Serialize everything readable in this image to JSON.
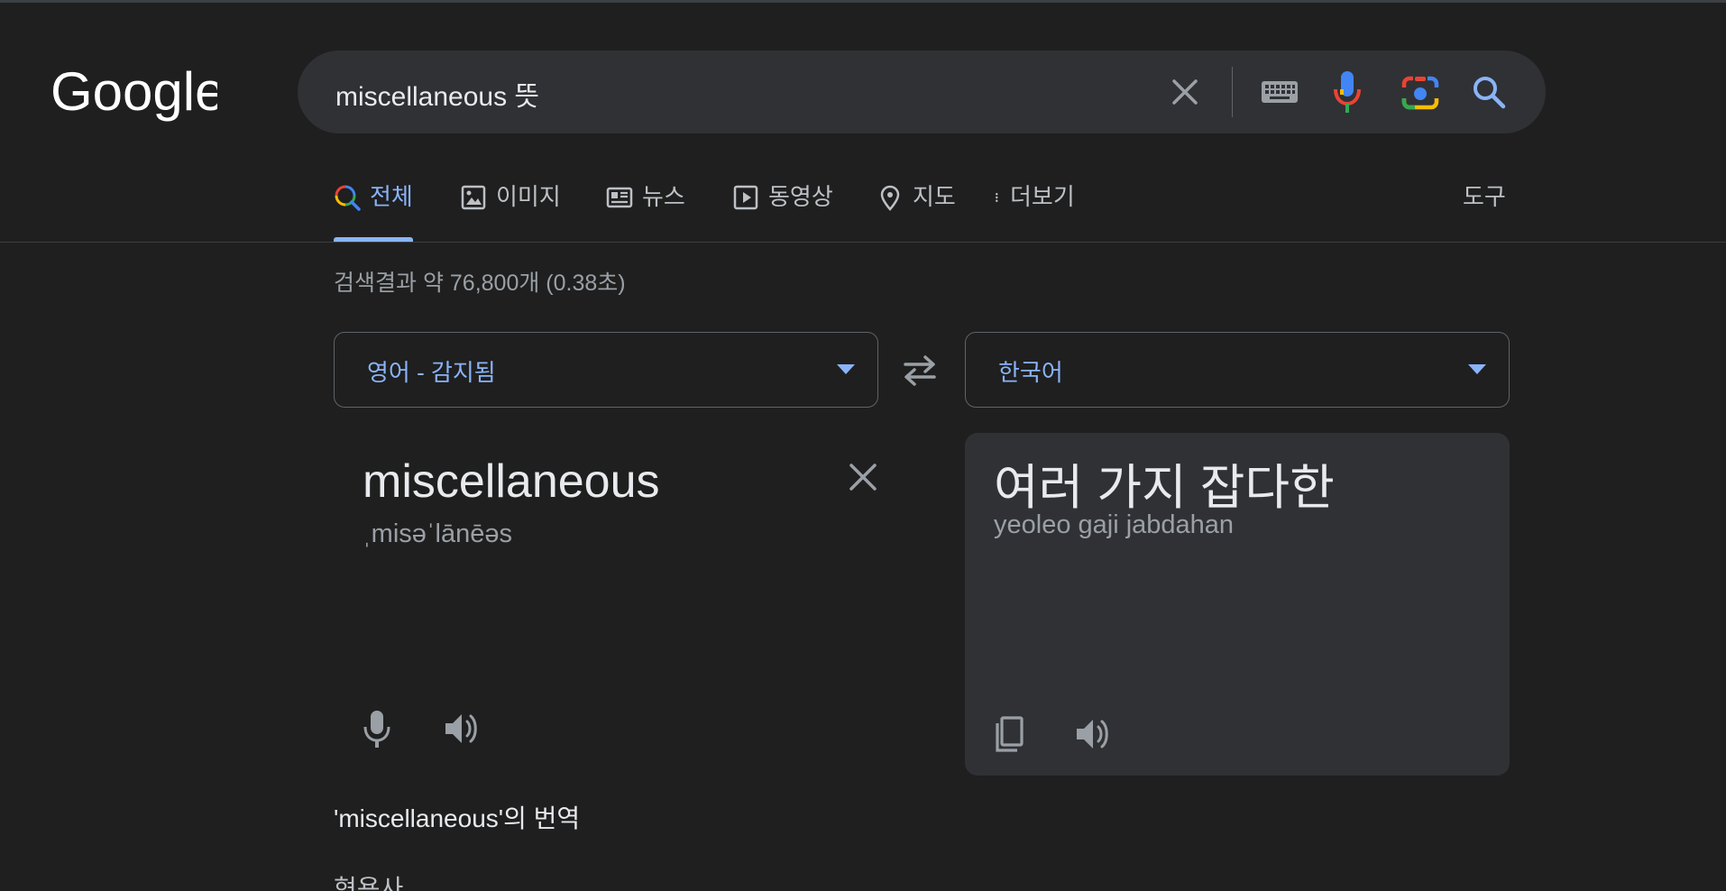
{
  "logo": {
    "text": "Google"
  },
  "search": {
    "query": "miscellaneous 뜻",
    "icons": [
      "clear-icon",
      "keyboard-icon",
      "mic-icon",
      "lens-icon",
      "search-icon"
    ]
  },
  "tabs": [
    {
      "label": "전체",
      "icon": "search-icon",
      "active": true
    },
    {
      "label": "이미지",
      "icon": "image-icon",
      "active": false
    },
    {
      "label": "뉴스",
      "icon": "news-icon",
      "active": false
    },
    {
      "label": "동영상",
      "icon": "video-icon",
      "active": false
    },
    {
      "label": "지도",
      "icon": "map-pin-icon",
      "active": false
    },
    {
      "label": "더보기",
      "icon": "more-vert-icon",
      "active": false
    }
  ],
  "tools_label": "도구",
  "result_stats": "검색결과 약 76,800개 (0.38초)",
  "translator": {
    "source_lang": "영어 - 감지됨",
    "target_lang": "한국어",
    "source_text": "miscellaneous",
    "source_phonetic": "ˌmisəˈlānēəs",
    "target_text": "여러 가지 잡다한",
    "target_romanized": "yeoleo gaji jabdahan"
  },
  "translation_heading": "'miscellaneous'의 번역",
  "part_of_speech": "형용사",
  "colors": {
    "background": "#1f1f1f",
    "surface": "#303134",
    "accent": "#8ab4f8",
    "text": "#e8eaed",
    "muted": "#9aa0a6"
  }
}
